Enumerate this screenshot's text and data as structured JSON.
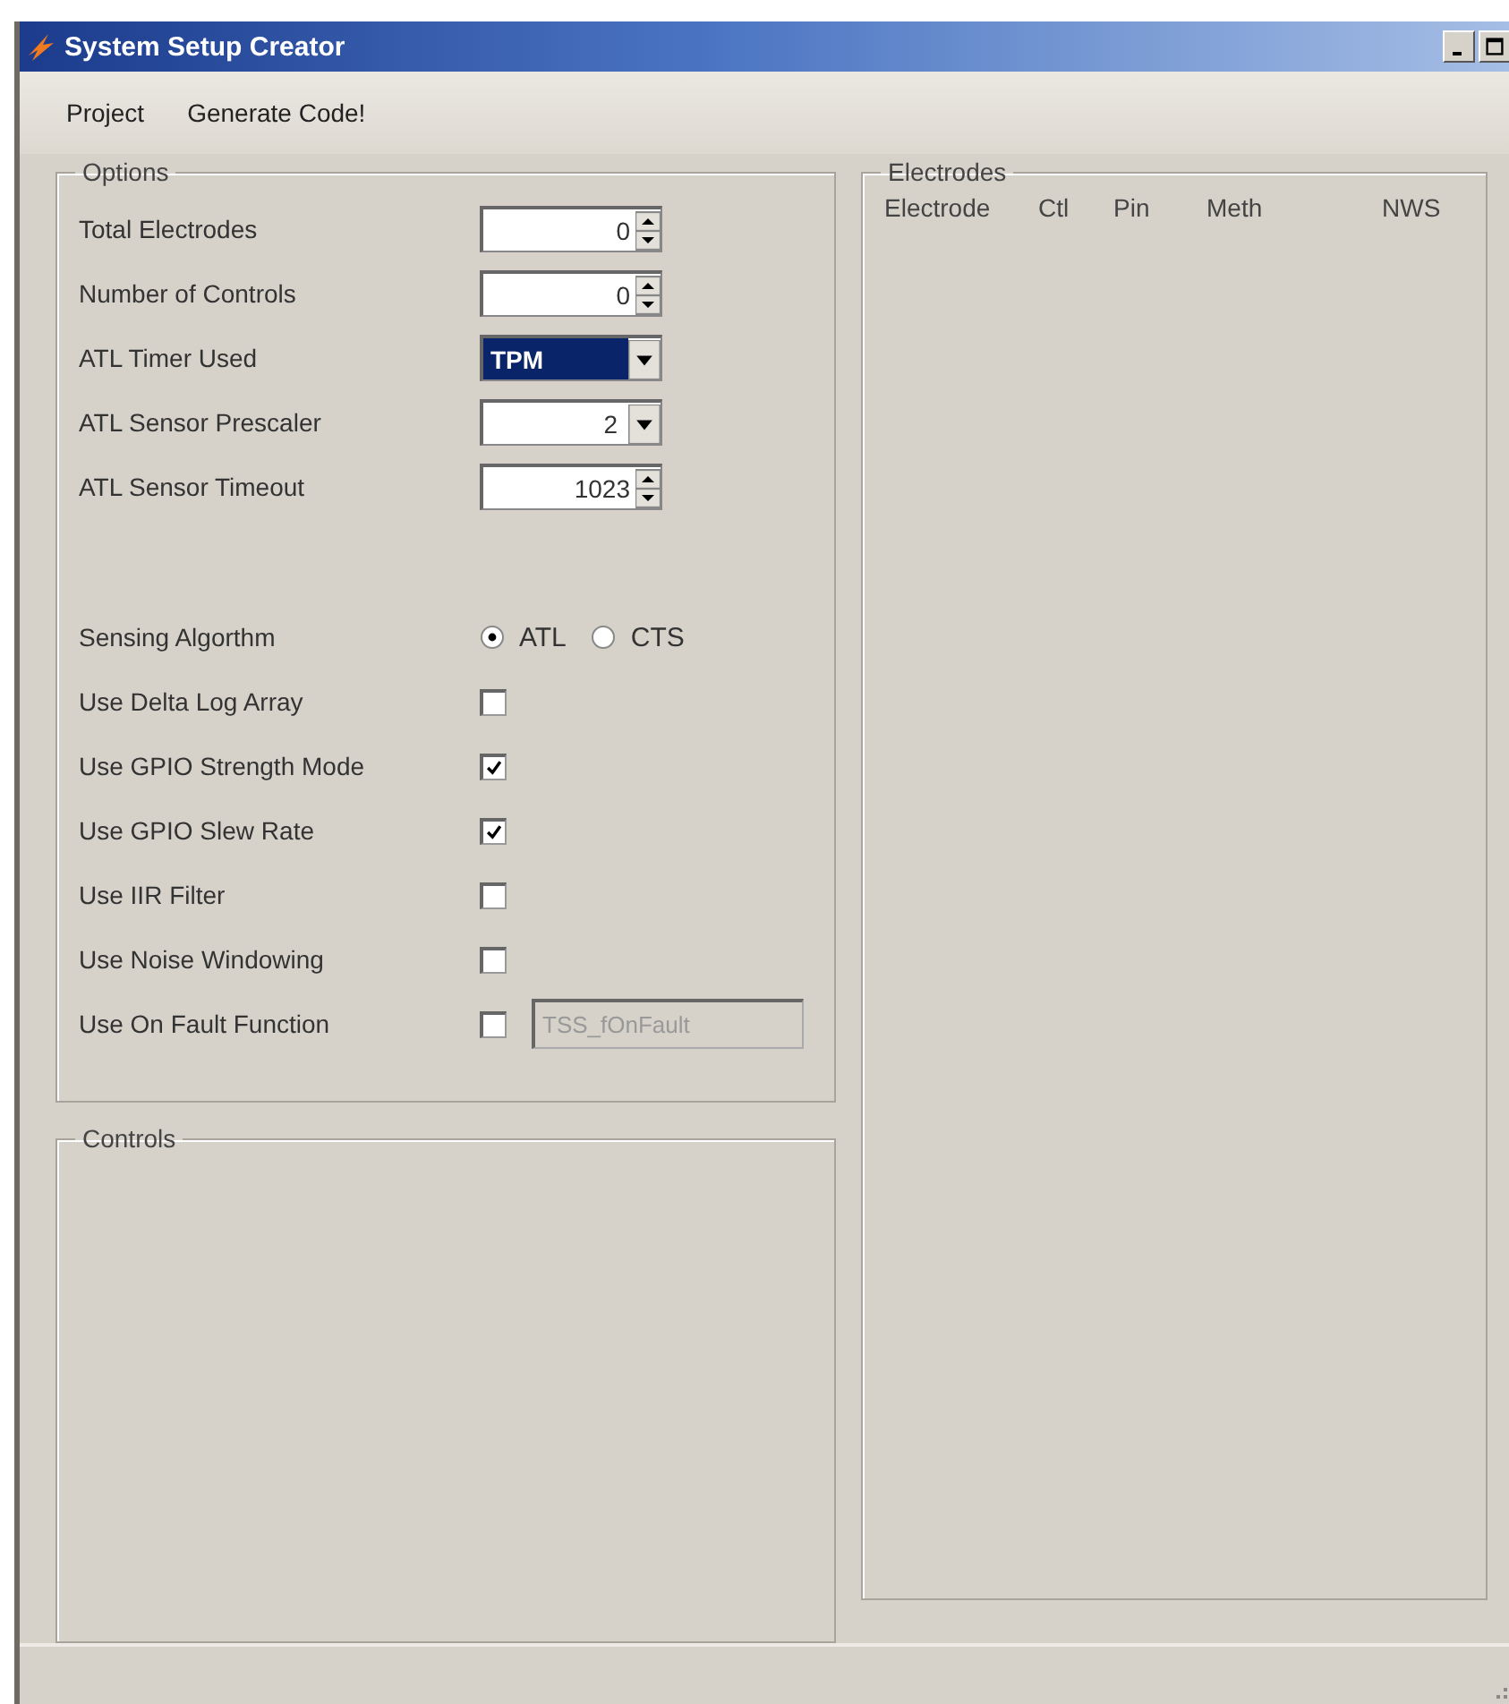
{
  "window": {
    "title": "System Setup Creator"
  },
  "menu": [
    "Project",
    "Generate Code!"
  ],
  "options": {
    "label": "Options",
    "items": [
      {
        "kind": "spin",
        "label": "Total Electrodes",
        "value": "0"
      },
      {
        "kind": "spin",
        "label": "Number of Controls",
        "value": "0"
      },
      {
        "kind": "combo",
        "label": "ATL Timer Used",
        "value": "TPM",
        "highlighted": true
      },
      {
        "kind": "combo",
        "label": "ATL Sensor Prescaler",
        "value": "2",
        "highlighted": false
      },
      {
        "kind": "spin",
        "label": "ATL Sensor Timeout",
        "value": "1023"
      },
      {
        "kind": "radio",
        "label": "Sensing Algorthm",
        "choices": [
          {
            "label": "ATL",
            "selected": true
          },
          {
            "label": "CTS",
            "selected": false
          }
        ]
      },
      {
        "kind": "check",
        "label": "Use Delta Log Array",
        "checked": false
      },
      {
        "kind": "check",
        "label": "Use GPIO Strength Mode",
        "checked": true
      },
      {
        "kind": "check",
        "label": "Use GPIO Slew Rate",
        "checked": true
      },
      {
        "kind": "check",
        "label": "Use IIR Filter",
        "checked": false
      },
      {
        "kind": "check",
        "label": "Use Noise Windowing",
        "checked": false
      },
      {
        "kind": "check_field",
        "label": "Use On Fault Function",
        "checked": false,
        "field": {
          "value": "TSS_fOnFault",
          "disabled": true
        }
      }
    ]
  },
  "controls": {
    "label": "Controls"
  },
  "electrodes": {
    "label": "Electrodes",
    "columns": [
      "Electrode",
      "Ctl",
      "Pin",
      "Meth",
      "NWS"
    ]
  }
}
